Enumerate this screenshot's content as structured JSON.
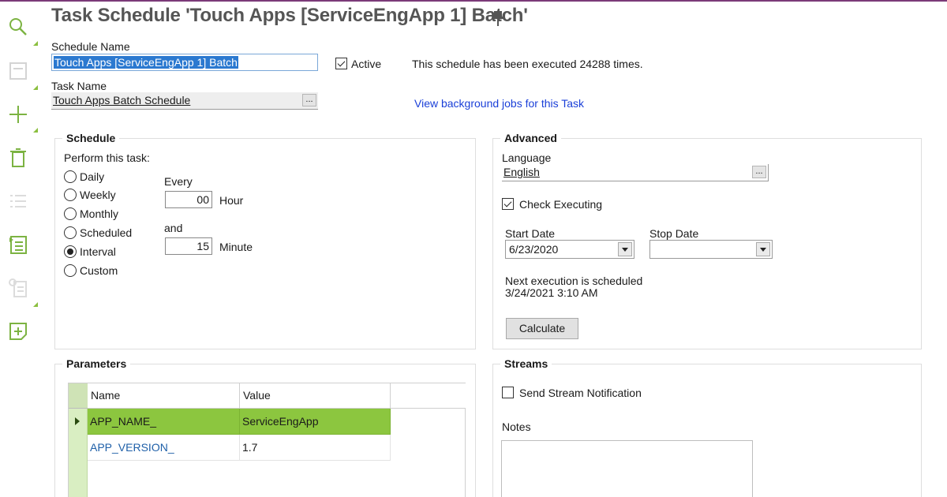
{
  "title": "Task Schedule 'Touch Apps [ServiceEngApp 1] Batch'",
  "schedule_name": {
    "label": "Schedule Name",
    "value": "Touch Apps [ServiceEngApp 1] Batch"
  },
  "active": {
    "label": "Active",
    "checked": true
  },
  "executed_text": "This schedule has been executed 24288 times.",
  "task_name": {
    "label": "Task Name",
    "value": "Touch Apps Batch Schedule",
    "lookup": "..."
  },
  "background_link": "View background jobs for this Task",
  "schedule": {
    "title": "Schedule",
    "perform_label": "Perform this task:",
    "options": [
      "Daily",
      "Weekly",
      "Monthly",
      "Scheduled",
      "Interval",
      "Custom"
    ],
    "selected": "Interval",
    "every_label": "Every",
    "hour_value": "00",
    "hour_label": "Hour",
    "and_label": "and",
    "minute_value": "15",
    "minute_label": "Minute"
  },
  "advanced": {
    "title": "Advanced",
    "language_label": "Language",
    "language_value": "English",
    "language_lookup": "...",
    "check_executing": {
      "label": "Check Executing",
      "checked": true
    },
    "start_date_label": "Start Date",
    "start_date_value": "6/23/2020",
    "stop_date_label": "Stop Date",
    "stop_date_value": "",
    "next_exec_label": "Next execution is scheduled",
    "next_exec_value": "3/24/2021 3:10 AM",
    "calculate_label": "Calculate"
  },
  "parameters": {
    "title": "Parameters",
    "columns": [
      "Name",
      "Value"
    ],
    "rows": [
      {
        "name": "APP_NAME_",
        "value": "ServiceEngApp",
        "selected": true
      },
      {
        "name": "APP_VERSION_",
        "value": "1.7",
        "selected": false
      }
    ]
  },
  "streams": {
    "title": "Streams",
    "send_notification": {
      "label": "Send Stream Notification",
      "checked": false
    },
    "notes_label": "Notes"
  },
  "colors": {
    "accent": "#8cc63f",
    "link": "#1a3fd8",
    "selection": "#2b79d0"
  },
  "toolbar_icons": [
    "search-icon",
    "save-icon",
    "add-icon",
    "delete-icon",
    "list-icon",
    "task-list-icon",
    "info-list-icon",
    "add-note-icon"
  ]
}
